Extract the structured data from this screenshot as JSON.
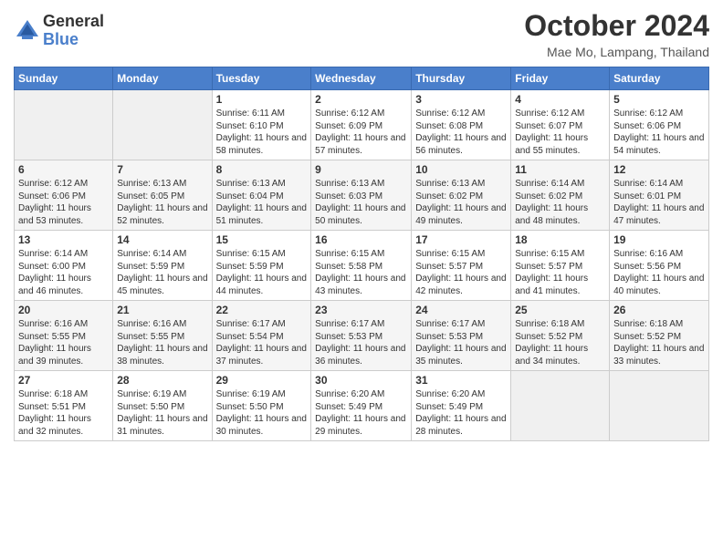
{
  "header": {
    "logo_general": "General",
    "logo_blue": "Blue",
    "title": "October 2024",
    "location": "Mae Mo, Lampang, Thailand"
  },
  "days_of_week": [
    "Sunday",
    "Monday",
    "Tuesday",
    "Wednesday",
    "Thursday",
    "Friday",
    "Saturday"
  ],
  "weeks": [
    [
      {
        "day": "",
        "info": ""
      },
      {
        "day": "",
        "info": ""
      },
      {
        "day": "1",
        "info": "Sunrise: 6:11 AM\nSunset: 6:10 PM\nDaylight: 11 hours and 58 minutes."
      },
      {
        "day": "2",
        "info": "Sunrise: 6:12 AM\nSunset: 6:09 PM\nDaylight: 11 hours and 57 minutes."
      },
      {
        "day": "3",
        "info": "Sunrise: 6:12 AM\nSunset: 6:08 PM\nDaylight: 11 hours and 56 minutes."
      },
      {
        "day": "4",
        "info": "Sunrise: 6:12 AM\nSunset: 6:07 PM\nDaylight: 11 hours and 55 minutes."
      },
      {
        "day": "5",
        "info": "Sunrise: 6:12 AM\nSunset: 6:06 PM\nDaylight: 11 hours and 54 minutes."
      }
    ],
    [
      {
        "day": "6",
        "info": "Sunrise: 6:12 AM\nSunset: 6:06 PM\nDaylight: 11 hours and 53 minutes."
      },
      {
        "day": "7",
        "info": "Sunrise: 6:13 AM\nSunset: 6:05 PM\nDaylight: 11 hours and 52 minutes."
      },
      {
        "day": "8",
        "info": "Sunrise: 6:13 AM\nSunset: 6:04 PM\nDaylight: 11 hours and 51 minutes."
      },
      {
        "day": "9",
        "info": "Sunrise: 6:13 AM\nSunset: 6:03 PM\nDaylight: 11 hours and 50 minutes."
      },
      {
        "day": "10",
        "info": "Sunrise: 6:13 AM\nSunset: 6:02 PM\nDaylight: 11 hours and 49 minutes."
      },
      {
        "day": "11",
        "info": "Sunrise: 6:14 AM\nSunset: 6:02 PM\nDaylight: 11 hours and 48 minutes."
      },
      {
        "day": "12",
        "info": "Sunrise: 6:14 AM\nSunset: 6:01 PM\nDaylight: 11 hours and 47 minutes."
      }
    ],
    [
      {
        "day": "13",
        "info": "Sunrise: 6:14 AM\nSunset: 6:00 PM\nDaylight: 11 hours and 46 minutes."
      },
      {
        "day": "14",
        "info": "Sunrise: 6:14 AM\nSunset: 5:59 PM\nDaylight: 11 hours and 45 minutes."
      },
      {
        "day": "15",
        "info": "Sunrise: 6:15 AM\nSunset: 5:59 PM\nDaylight: 11 hours and 44 minutes."
      },
      {
        "day": "16",
        "info": "Sunrise: 6:15 AM\nSunset: 5:58 PM\nDaylight: 11 hours and 43 minutes."
      },
      {
        "day": "17",
        "info": "Sunrise: 6:15 AM\nSunset: 5:57 PM\nDaylight: 11 hours and 42 minutes."
      },
      {
        "day": "18",
        "info": "Sunrise: 6:15 AM\nSunset: 5:57 PM\nDaylight: 11 hours and 41 minutes."
      },
      {
        "day": "19",
        "info": "Sunrise: 6:16 AM\nSunset: 5:56 PM\nDaylight: 11 hours and 40 minutes."
      }
    ],
    [
      {
        "day": "20",
        "info": "Sunrise: 6:16 AM\nSunset: 5:55 PM\nDaylight: 11 hours and 39 minutes."
      },
      {
        "day": "21",
        "info": "Sunrise: 6:16 AM\nSunset: 5:55 PM\nDaylight: 11 hours and 38 minutes."
      },
      {
        "day": "22",
        "info": "Sunrise: 6:17 AM\nSunset: 5:54 PM\nDaylight: 11 hours and 37 minutes."
      },
      {
        "day": "23",
        "info": "Sunrise: 6:17 AM\nSunset: 5:53 PM\nDaylight: 11 hours and 36 minutes."
      },
      {
        "day": "24",
        "info": "Sunrise: 6:17 AM\nSunset: 5:53 PM\nDaylight: 11 hours and 35 minutes."
      },
      {
        "day": "25",
        "info": "Sunrise: 6:18 AM\nSunset: 5:52 PM\nDaylight: 11 hours and 34 minutes."
      },
      {
        "day": "26",
        "info": "Sunrise: 6:18 AM\nSunset: 5:52 PM\nDaylight: 11 hours and 33 minutes."
      }
    ],
    [
      {
        "day": "27",
        "info": "Sunrise: 6:18 AM\nSunset: 5:51 PM\nDaylight: 11 hours and 32 minutes."
      },
      {
        "day": "28",
        "info": "Sunrise: 6:19 AM\nSunset: 5:50 PM\nDaylight: 11 hours and 31 minutes."
      },
      {
        "day": "29",
        "info": "Sunrise: 6:19 AM\nSunset: 5:50 PM\nDaylight: 11 hours and 30 minutes."
      },
      {
        "day": "30",
        "info": "Sunrise: 6:20 AM\nSunset: 5:49 PM\nDaylight: 11 hours and 29 minutes."
      },
      {
        "day": "31",
        "info": "Sunrise: 6:20 AM\nSunset: 5:49 PM\nDaylight: 11 hours and 28 minutes."
      },
      {
        "day": "",
        "info": ""
      },
      {
        "day": "",
        "info": ""
      }
    ]
  ]
}
